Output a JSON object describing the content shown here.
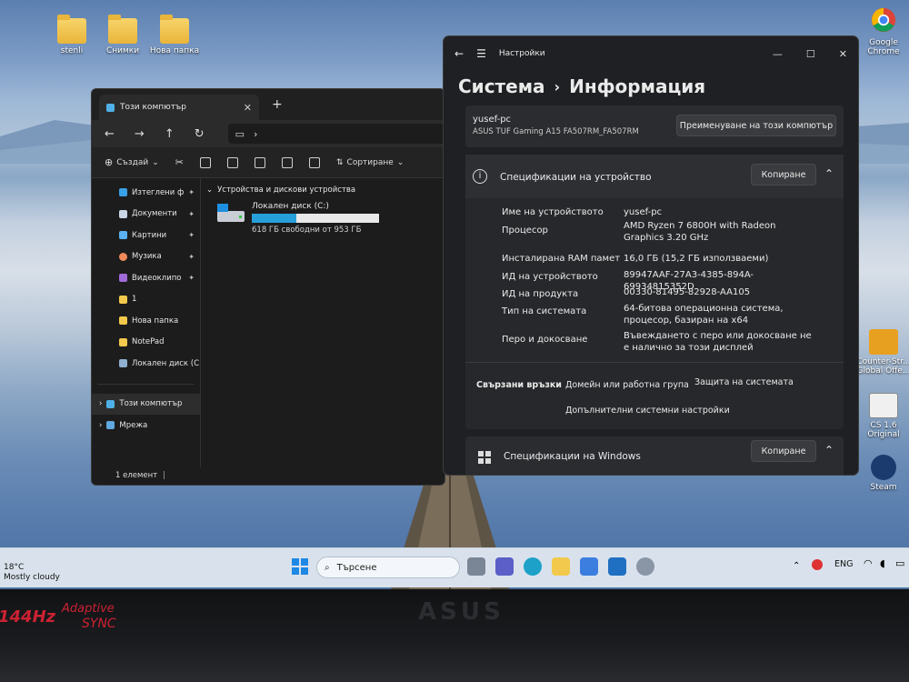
{
  "desktop": {
    "icons_left": [
      {
        "label": "stenli"
      },
      {
        "label": "Снимки"
      },
      {
        "label": "Нова папка"
      }
    ],
    "icons_right": [
      {
        "label": "Google Chrome",
        "icon": "chrome-icon"
      },
      {
        "label": "Counter-Str... Global Offe...",
        "icon": "csgo-icon"
      },
      {
        "label": "CS 1.6 Original",
        "icon": "cs16-icon"
      },
      {
        "label": "Steam",
        "icon": "steam-icon"
      }
    ]
  },
  "explorer": {
    "tab_title": "Този компютър",
    "toolbar": {
      "new_label": "Създай",
      "sort_label": "Сортиране"
    },
    "sidebar": [
      {
        "label": "Изтеглени ф",
        "color": "#3aa0e8",
        "pinned": true
      },
      {
        "label": "Документи",
        "color": "#c9d6e6",
        "pinned": true
      },
      {
        "label": "Картини",
        "color": "#5ab0f0",
        "pinned": true
      },
      {
        "label": "Музика",
        "color": "#f08a5a",
        "pinned": true
      },
      {
        "label": "Видеоклипо",
        "color": "#a06ad8",
        "pinned": true
      },
      {
        "label": "1",
        "color": "#f2c94c",
        "pinned": false
      },
      {
        "label": "Нова папка",
        "color": "#f2c94c",
        "pinned": false
      },
      {
        "label": "NotePad",
        "color": "#f2c94c",
        "pinned": false
      },
      {
        "label": "Локален диск (C",
        "color": "#8fb0d0",
        "pinned": false
      }
    ],
    "tree": [
      {
        "label": "Този компютър"
      },
      {
        "label": "Мрежа"
      }
    ],
    "section_title": "Устройства и дискови устройства",
    "drive": {
      "name": "Локален диск (C:)",
      "free_text": "618 ГБ свободни от 953 ГБ",
      "used_fraction": 0.35
    },
    "status": "1 елемент"
  },
  "settings": {
    "app_title": "Настройки",
    "breadcrumb": {
      "parent": "Система",
      "separator": "›",
      "current": "Информация"
    },
    "device": {
      "name": "yusef-pc",
      "model": "ASUS TUF Gaming A15 FA507RM_FA507RM",
      "rename_button": "Преименуване на този компютър"
    },
    "specs": {
      "title": "Спецификации на устройство",
      "copy_button": "Копиране",
      "rows": [
        {
          "label": "Име на устройството",
          "value": "yusef-pc"
        },
        {
          "label": "Процесор",
          "value": "AMD Ryzen 7 6800H with Radeon Graphics 3.20 GHz"
        },
        {
          "label": "Инсталирана RAM памет",
          "value": "16,0 ГБ (15,2 ГБ използваеми)"
        },
        {
          "label": "ИД на устройството",
          "value": "89947AAF-27A3-4385-894A-69934815352D"
        },
        {
          "label": "ИД на продукта",
          "value": "00330-81495-82928-AA105"
        },
        {
          "label": "Тип на системата",
          "value": "64-битова операционна система, процесор, базиран на x64"
        },
        {
          "label": "Перо и докосване",
          "value": "Въвеждането с перо или докосване не е налично за този дисплей"
        }
      ]
    },
    "related": {
      "links": [
        "Свързани връзки",
        "Домейн или работна група",
        "Защита на системата"
      ],
      "advanced": "Допълнителни системни настройки"
    },
    "windows_specs": {
      "title": "Спецификации на Windows",
      "copy_button": "Копиране"
    }
  },
  "taskbar": {
    "weather": {
      "temp": "18°C",
      "desc": "Mostly cloudy"
    },
    "search_placeholder": "Търсене",
    "language": "ENG"
  },
  "bezel": {
    "brand": "ASUS",
    "refresh": "144Hz",
    "sync_line1": "Adaptive",
    "sync_line2": "SYNC"
  }
}
